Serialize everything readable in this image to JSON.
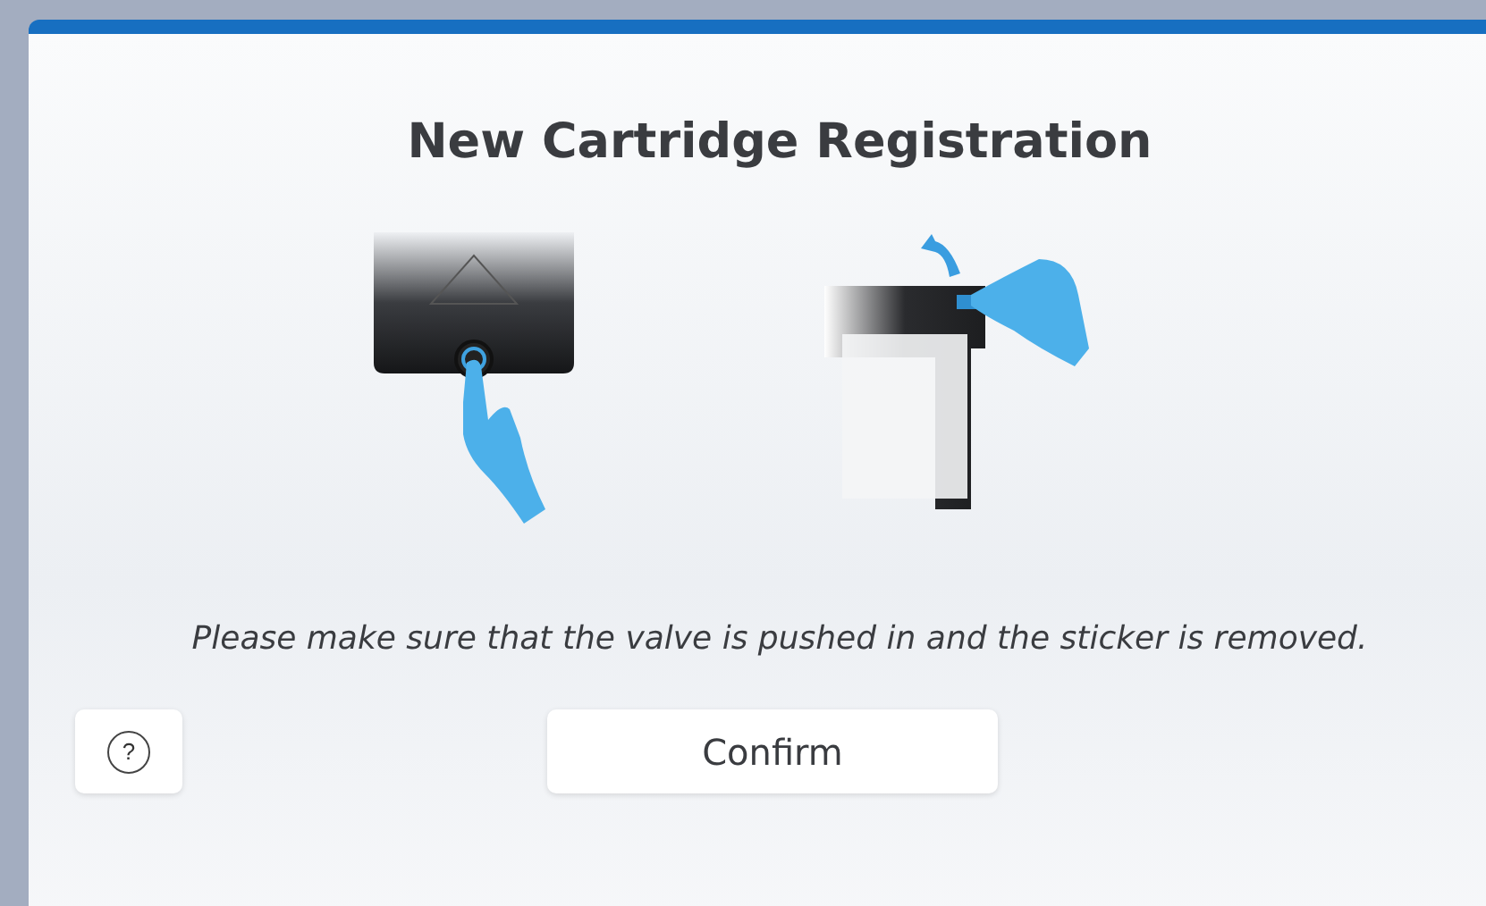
{
  "dialog": {
    "title": "New Cartridge Registration",
    "message": "Please make sure that the valve is pushed in and the sticker is removed.",
    "help_button": {
      "label": "?"
    },
    "buttons": [
      {
        "label": "Confirm"
      }
    ]
  }
}
